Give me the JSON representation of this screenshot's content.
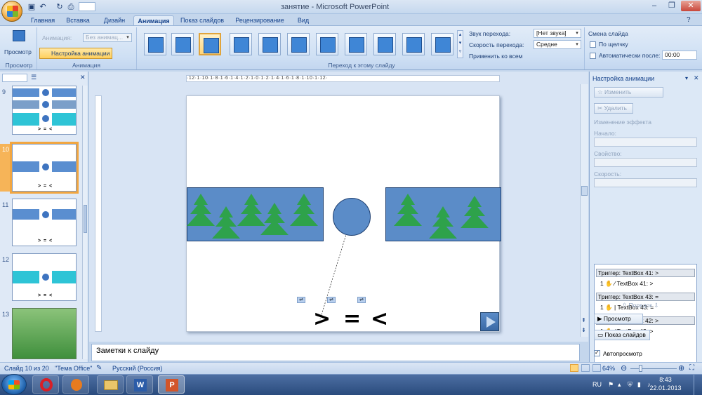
{
  "window": {
    "title": "занятие - Microsoft PowerPoint"
  },
  "tabs": [
    "Главная",
    "Вставка",
    "Дизайн",
    "Анимация",
    "Показ слайдов",
    "Рецензирование",
    "Вид"
  ],
  "active_tab": "Анимация",
  "ribbon": {
    "preview_label": "Просмотр",
    "preview_group": "Просмотр",
    "animation_label": "Анимация:",
    "animation_value": "Без анимац...",
    "custom_animation": "Настройка анимации",
    "animation_group": "Анимация",
    "transition_group": "Переход к этому слайду",
    "sound_label": "Звук перехода:",
    "sound_value": "[Нет звука]",
    "speed_label": "Скорость перехода:",
    "speed_value": "Средне",
    "apply_all": "Применить ко всем",
    "slide_change_title": "Смена слайда",
    "on_click": "По щелчку",
    "auto_after": "Автоматически после:",
    "auto_time": "00:00"
  },
  "slides": [
    {
      "num": "9",
      "caption": "> = <"
    },
    {
      "num": "10",
      "caption": "> = <"
    },
    {
      "num": "11",
      "caption": "> = <"
    },
    {
      "num": "12",
      "caption": "> = <"
    },
    {
      "num": "13"
    }
  ],
  "ruler": {
    "h": "·12·1·10·1·8·1·6·1·4·1·2·1·0·1·2·1·4·1·6·1·8·1·10·1·12·"
  },
  "slide_symbols": {
    "gt": ">",
    "eq": "=",
    "lt": "<"
  },
  "notes": {
    "placeholder": "Заметки к слайду"
  },
  "task_pane": {
    "title": "Настройка анимации",
    "change_btn": "Изменить",
    "delete_btn": "Удалить",
    "effect_change": "Изменение эффекта",
    "start_label": "Начало:",
    "property_label": "Свойство:",
    "speed_label": "Скорость:",
    "triggers": [
      {
        "trigger": "Триггер: TextBox 41: >",
        "item_num": "1",
        "item": "TextBox 41: >"
      },
      {
        "trigger": "Триггер: TextBox 43: =",
        "item_num": "1",
        "item": "TextBox 43: ="
      },
      {
        "trigger": "Триггер: TextBox 42: >",
        "item_num": "1",
        "item": "TextBox 42: >"
      }
    ],
    "order_label": "Порядок",
    "preview_btn": "Просмотр",
    "slideshow_btn": "Показ слайдов",
    "autopreview": "Автопросмотр"
  },
  "status": {
    "slide_info": "Слайд 10 из 20",
    "theme": "\"Тема Office\"",
    "language": "Русский (Россия)",
    "zoom": "64%"
  },
  "taskbar": {
    "lang": "RU",
    "time": "8:43",
    "date": "22.01.2013"
  },
  "colors": {
    "accent": "#5b8cc8",
    "tree": "#2ea24b",
    "ribbon": "#dfeaf7",
    "selected": "#f2a640"
  }
}
